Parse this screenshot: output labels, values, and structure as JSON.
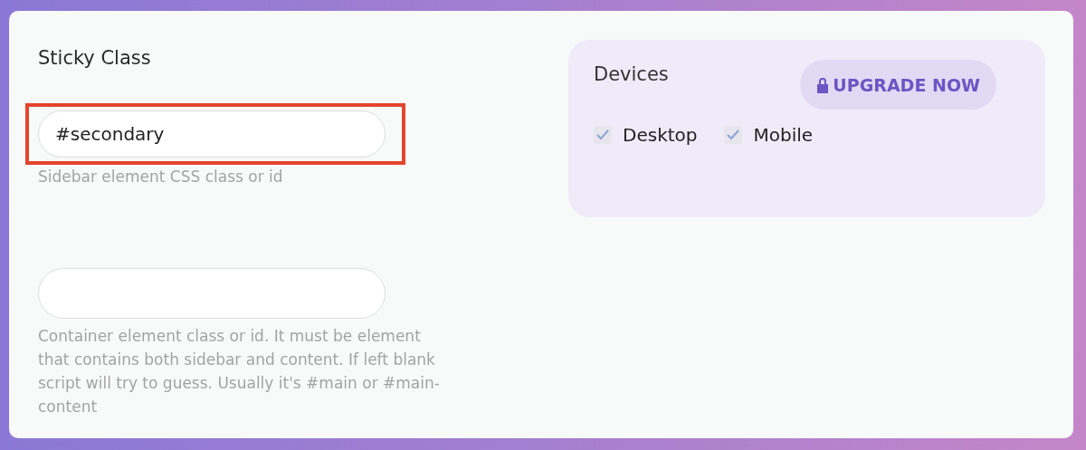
{
  "left": {
    "title": "Sticky Class",
    "fields": [
      {
        "value": "#secondary",
        "highlighted": true,
        "hint": "Sidebar element CSS class or id"
      },
      {
        "highlighted": false,
        "hint": "Container element class or id. It must be element that contains both sidebar and content. If left blank script will try to guess. Usually it's #main or #main-content"
      }
    ]
  },
  "devices": {
    "title": "Devices",
    "upgrade_button": "UPGRADE NOW",
    "options": [
      {
        "label": "Desktop",
        "checked": true
      },
      {
        "label": "Mobile",
        "checked": true
      }
    ]
  }
}
